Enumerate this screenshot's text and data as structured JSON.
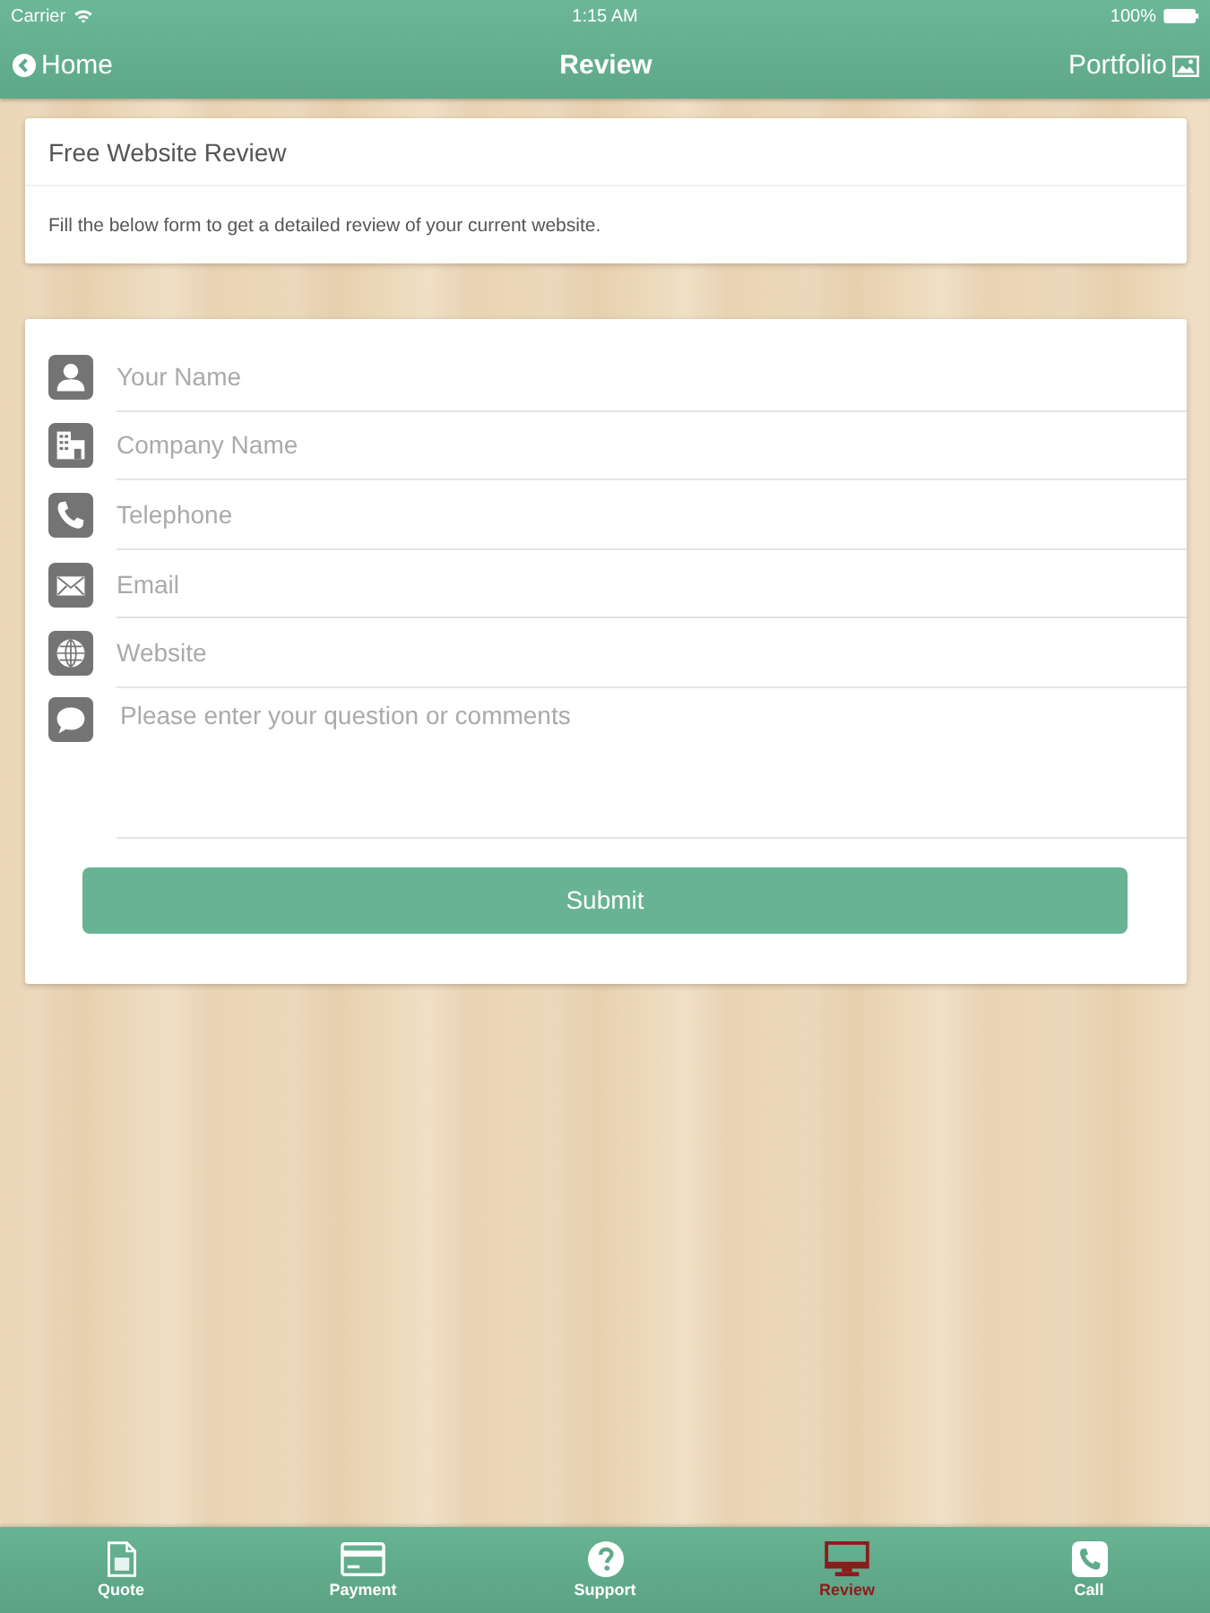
{
  "status_bar": {
    "carrier": "Carrier",
    "time": "1:15 AM",
    "battery": "100%"
  },
  "nav_bar": {
    "back": "Home",
    "title": "Review",
    "action": "Portfolio"
  },
  "intro_card": {
    "title": "Free Website Review",
    "text": "Fill the below form to get a detailed review of your current website."
  },
  "form": {
    "fields": [
      {
        "kind": "line",
        "placeholder": "Your Name"
      },
      {
        "kind": "line",
        "placeholder": "Company Name"
      },
      {
        "kind": "line",
        "placeholder": "Telephone"
      },
      {
        "kind": "line",
        "placeholder": "Email"
      },
      {
        "kind": "line",
        "placeholder": "Website"
      },
      {
        "kind": "area",
        "placeholder": "Please enter your question or comments"
      }
    ],
    "submit": "Submit"
  },
  "tab_bar": [
    {
      "label": "Quote",
      "selected": false
    },
    {
      "label": "Payment",
      "selected": false
    },
    {
      "label": "Support",
      "selected": false
    },
    {
      "label": "Review",
      "selected": true
    },
    {
      "label": "Call",
      "selected": false
    }
  ]
}
